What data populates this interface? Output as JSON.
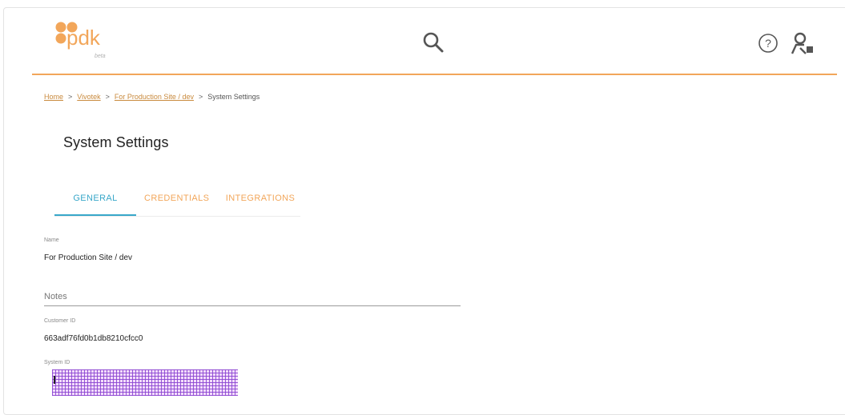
{
  "header": {
    "logo_text": "pdk",
    "logo_badge": "beta",
    "search_icon": "search-icon",
    "help_icon": "help-circle-icon",
    "user_icon": "user-account-icon",
    "accent": "#f2a65a"
  },
  "breadcrumb": {
    "items": [
      "Home",
      "Vivotek",
      "For Production Site / dev"
    ],
    "current": "System Settings",
    "separator": ">"
  },
  "page": {
    "title": "System Settings"
  },
  "tabs": [
    {
      "label": "GENERAL",
      "active": true
    },
    {
      "label": "CREDENTIALS",
      "active": false
    },
    {
      "label": "INTEGRATIONS",
      "active": false
    }
  ],
  "fields": {
    "name_label": "Name",
    "name_value": "For Production Site / dev",
    "notes_placeholder": "Notes",
    "customer_id_label": "Customer ID",
    "customer_id_value": "663adf76fd0b1db8210cfcc0",
    "system_id_label": "System ID"
  },
  "colors": {
    "tab_active": "#38a7c9",
    "tab_inactive": "#f2a65a",
    "link": "#c98a3d"
  }
}
